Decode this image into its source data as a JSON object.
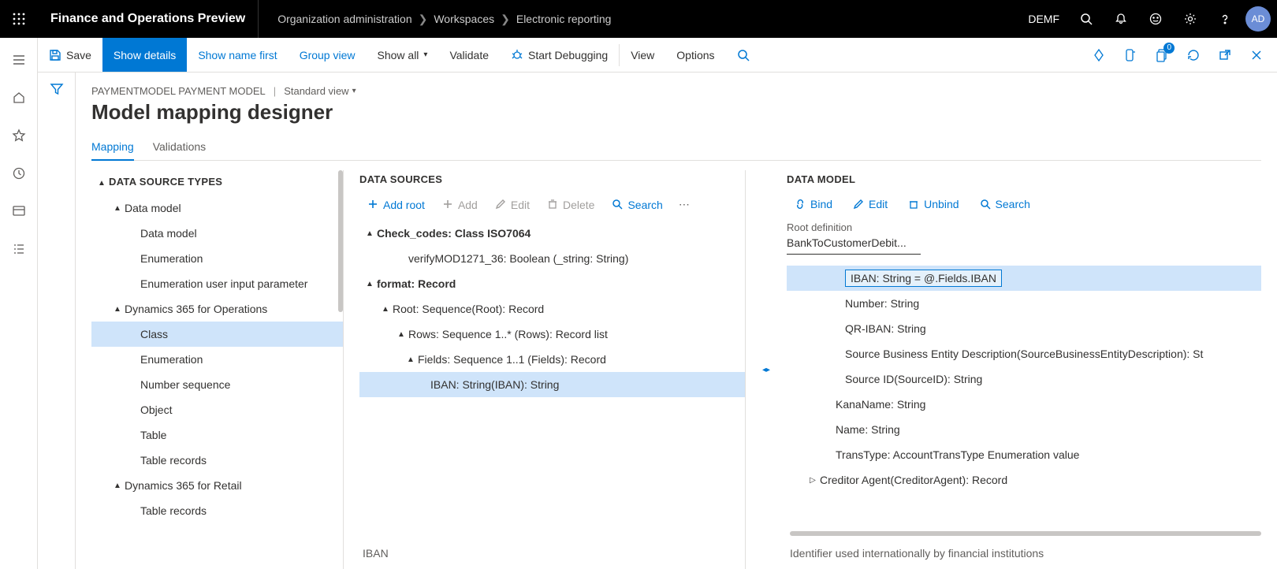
{
  "header": {
    "app_title": "Finance and Operations Preview",
    "breadcrumbs": [
      "Organization administration",
      "Workspaces",
      "Electronic reporting"
    ],
    "entity": "DEMF",
    "avatar": "AD"
  },
  "action_bar": {
    "save": "Save",
    "show_details": "Show details",
    "show_name_first": "Show name first",
    "group_view": "Group view",
    "show_all": "Show all",
    "validate": "Validate",
    "start_debugging": "Start Debugging",
    "view": "View",
    "options": "Options",
    "badge": "0"
  },
  "page": {
    "meta_left": "PAYMENTMODEL PAYMENT MODEL",
    "view_label": "Standard view",
    "title": "Model mapping designer",
    "tabs": {
      "mapping": "Mapping",
      "validations": "Validations"
    }
  },
  "panel1": {
    "title": "DATA SOURCE TYPES",
    "nodes": {
      "dm_group": "Data model",
      "dm": "Data model",
      "enum1": "Enumeration",
      "enum_uip": "Enumeration user input parameter",
      "d365o": "Dynamics 365 for Operations",
      "class": "Class",
      "enum2": "Enumeration",
      "numseq": "Number sequence",
      "object": "Object",
      "table": "Table",
      "tblrec1": "Table records",
      "d365r": "Dynamics 365 for Retail",
      "tblrec2": "Table records"
    }
  },
  "panel2": {
    "title": "DATA SOURCES",
    "toolbar": {
      "add_root": "Add root",
      "add": "Add",
      "edit": "Edit",
      "delete": "Delete",
      "search": "Search"
    },
    "nodes": {
      "check_codes": "Check_codes: Class ISO7064",
      "verify": "verifyMOD1271_36: Boolean (_string: String)",
      "format": "format: Record",
      "root": "Root: Sequence(Root): Record",
      "rows": "Rows: Sequence 1..* (Rows): Record list",
      "fields": "Fields: Sequence 1..1 (Fields): Record",
      "iban": "IBAN: String(IBAN): String"
    },
    "selected_label": "IBAN"
  },
  "panel3": {
    "title": "DATA MODEL",
    "toolbar": {
      "bind": "Bind",
      "edit": "Edit",
      "unbind": "Unbind",
      "search": "Search"
    },
    "root_def_label": "Root definition",
    "root_def_value": "BankToCustomerDebit...",
    "nodes": {
      "iban": "IBAN: String = @.Fields.IBAN",
      "number": "Number: String",
      "qriban": "QR-IBAN: String",
      "sbed": "Source Business Entity Description(SourceBusinessEntityDescription): St",
      "srcid": "Source ID(SourceID): String",
      "kana": "KanaName: String",
      "name": "Name: String",
      "trans": "TransType: AccountTransType Enumeration value",
      "cred": "Creditor Agent(CreditorAgent): Record"
    },
    "description": "Identifier used internationally by financial institutions"
  }
}
